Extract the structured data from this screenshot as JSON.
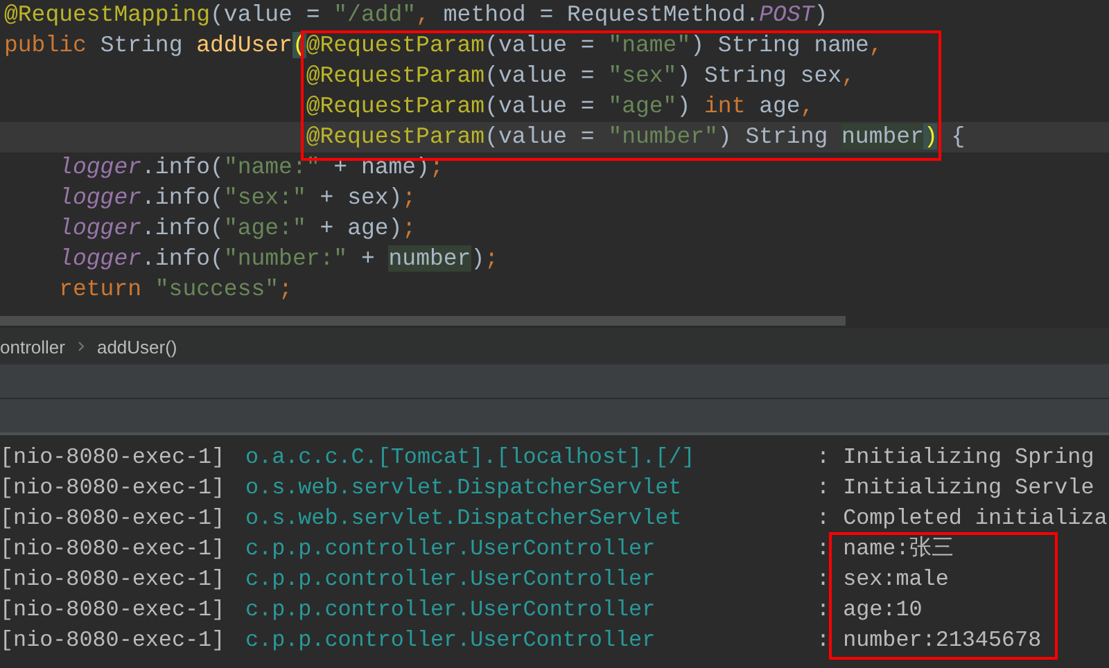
{
  "editor": {
    "header_lines": [
      {
        "current": false,
        "tokens": [
          {
            "kind": "ann",
            "text": "@RequestMapping"
          },
          {
            "kind": "txt",
            "text": "(value = "
          },
          {
            "kind": "str",
            "text": "\"/add\""
          },
          {
            "kind": "kw",
            "text": ", "
          },
          {
            "kind": "txt",
            "text": "method = RequestMethod."
          },
          {
            "kind": "cst",
            "text": "POST"
          },
          {
            "kind": "txt",
            "text": ")"
          }
        ]
      },
      {
        "current": false,
        "tokens": [
          {
            "kind": "kw",
            "text": "public "
          },
          {
            "kind": "txt",
            "text": "String "
          },
          {
            "kind": "method",
            "text": "addUser"
          },
          {
            "kind": "brace",
            "text": "("
          },
          {
            "kind": "ann",
            "text": "@RequestParam"
          },
          {
            "kind": "txt",
            "text": "(value = "
          },
          {
            "kind": "str",
            "text": "\"name\""
          },
          {
            "kind": "txt",
            "text": ") String name"
          },
          {
            "kind": "kw",
            "text": ","
          }
        ]
      }
    ],
    "param_lines": [
      {
        "current": false,
        "tokens": [
          {
            "kind": "ann",
            "text": "@RequestParam"
          },
          {
            "kind": "txt",
            "text": "(value = "
          },
          {
            "kind": "str",
            "text": "\"sex\""
          },
          {
            "kind": "txt",
            "text": ") String sex"
          },
          {
            "kind": "kw",
            "text": ","
          }
        ]
      },
      {
        "current": false,
        "tokens": [
          {
            "kind": "ann",
            "text": "@RequestParam"
          },
          {
            "kind": "txt",
            "text": "(value = "
          },
          {
            "kind": "str",
            "text": "\"age\""
          },
          {
            "kind": "txt",
            "text": ") "
          },
          {
            "kind": "kw",
            "text": "int "
          },
          {
            "kind": "txt",
            "text": "age"
          },
          {
            "kind": "kw",
            "text": ","
          }
        ]
      },
      {
        "current": true,
        "tokens": [
          {
            "kind": "ann",
            "text": "@RequestParam"
          },
          {
            "kind": "txt",
            "text": "(value = "
          },
          {
            "kind": "str",
            "text": "\"number\""
          },
          {
            "kind": "txt",
            "text": ") String "
          },
          {
            "kind": "hl",
            "text": "number"
          },
          {
            "kind": "brace",
            "text": ")"
          },
          {
            "kind": "txt",
            "text": " {"
          }
        ]
      }
    ],
    "body_lines": [
      {
        "current": false,
        "tokens": [
          {
            "kind": "fld",
            "text": "logger"
          },
          {
            "kind": "txt",
            "text": ".info("
          },
          {
            "kind": "str",
            "text": "\"name:\""
          },
          {
            "kind": "txt",
            "text": " + name)"
          },
          {
            "kind": "kw",
            "text": ";"
          }
        ]
      },
      {
        "current": false,
        "tokens": [
          {
            "kind": "fld",
            "text": "logger"
          },
          {
            "kind": "txt",
            "text": ".info("
          },
          {
            "kind": "str",
            "text": "\"sex:\""
          },
          {
            "kind": "txt",
            "text": " + sex)"
          },
          {
            "kind": "kw",
            "text": ";"
          }
        ]
      },
      {
        "current": false,
        "tokens": [
          {
            "kind": "fld",
            "text": "logger"
          },
          {
            "kind": "txt",
            "text": ".info("
          },
          {
            "kind": "str",
            "text": "\"age:\""
          },
          {
            "kind": "txt",
            "text": " + age)"
          },
          {
            "kind": "kw",
            "text": ";"
          }
        ]
      },
      {
        "current": false,
        "tokens": [
          {
            "kind": "fld",
            "text": "logger"
          },
          {
            "kind": "txt",
            "text": ".info("
          },
          {
            "kind": "str",
            "text": "\"number:\""
          },
          {
            "kind": "txt",
            "text": " + "
          },
          {
            "kind": "hl",
            "text": "number"
          },
          {
            "kind": "txt",
            "text": ")"
          },
          {
            "kind": "kw",
            "text": ";"
          }
        ]
      },
      {
        "current": false,
        "tokens": [
          {
            "kind": "kw",
            "text": "return "
          },
          {
            "kind": "str",
            "text": "\"success\""
          },
          {
            "kind": "kw",
            "text": ";"
          }
        ]
      }
    ]
  },
  "breadcrumb": [
    "ontroller",
    "addUser()"
  ],
  "console": {
    "rows": [
      {
        "thread": "[nio-8080-exec-1]",
        "logger": "o.a.c.c.C.[Tomcat].[localhost].[/]",
        "message": ": Initializing Spring"
      },
      {
        "thread": "[nio-8080-exec-1]",
        "logger": "o.s.web.servlet.DispatcherServlet",
        "message": ": Initializing Servle"
      },
      {
        "thread": "[nio-8080-exec-1]",
        "logger": "o.s.web.servlet.DispatcherServlet",
        "message": ": Completed initializa"
      },
      {
        "thread": "[nio-8080-exec-1]",
        "logger": "c.p.p.controller.UserController",
        "message": ": name:张三"
      },
      {
        "thread": "[nio-8080-exec-1]",
        "logger": "c.p.p.controller.UserController",
        "message": ": sex:male"
      },
      {
        "thread": "[nio-8080-exec-1]",
        "logger": "c.p.p.controller.UserController",
        "message": ": age:10"
      },
      {
        "thread": "[nio-8080-exec-1]",
        "logger": "c.p.p.controller.UserController",
        "message": ": number:21345678"
      }
    ]
  }
}
